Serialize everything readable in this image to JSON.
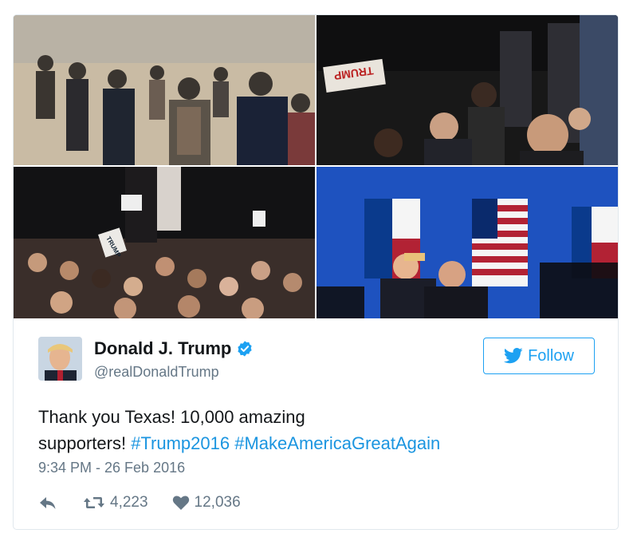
{
  "photos": [
    {
      "alt": "crowd-outdoors-photo"
    },
    {
      "alt": "press-photographers-photo",
      "sign_text": "TRUMP"
    },
    {
      "alt": "rally-crowd-photo",
      "sign_text": "TRUMP"
    },
    {
      "alt": "stage-flags-photo"
    }
  ],
  "author": {
    "name": "Donald J. Trump",
    "handle": "@realDonaldTrump",
    "verified": true
  },
  "follow": {
    "label": "Follow"
  },
  "tweet": {
    "text_plain": "Thank you Texas! 10,000 amazing supporters!",
    "line1": "Thank you Texas! 10,000 amazing",
    "line2_plain": "supporters!",
    "hashtags": [
      "#Trump2016",
      "#MakeAmericaGreatAgain"
    ],
    "timestamp": "9:34 PM - 26 Feb 2016"
  },
  "actions": {
    "reply": {
      "icon": "reply-icon"
    },
    "retweet": {
      "icon": "retweet-icon",
      "count": "4,223"
    },
    "like": {
      "icon": "heart-icon",
      "count": "12,036"
    }
  },
  "colors": {
    "link": "#1b95e0",
    "twitter_blue": "#1da1f2",
    "secondary_text": "#657786",
    "border": "#e1e8ed"
  }
}
